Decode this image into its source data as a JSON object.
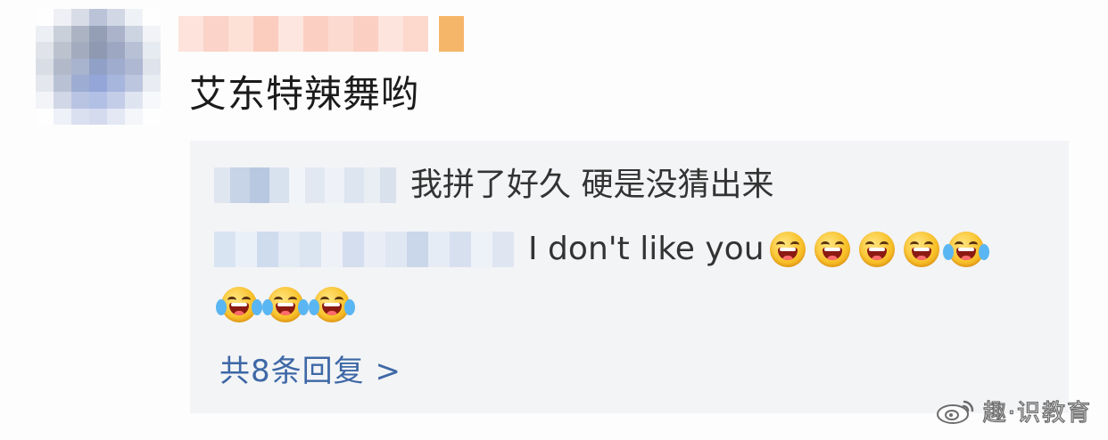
{
  "comment": {
    "text": "艾东特辣舞哟"
  },
  "replies": [
    {
      "text": "我拼了好久 硬是没猜出来"
    },
    {
      "text": "I don't like you",
      "emoji_inline": [
        "grinning-face-icon",
        "grinning-face-icon",
        "grinning-face-icon",
        "grinning-face-icon",
        "tears-of-joy-icon"
      ],
      "emoji_wrapped": [
        "tears-of-joy-icon",
        "tears-of-joy-icon",
        "tears-of-joy-icon"
      ]
    }
  ],
  "more_replies": {
    "label": "共8条回复 >"
  },
  "watermark": {
    "icon": "weibo-logo-icon",
    "text": "趣·识教育"
  },
  "colors": {
    "reply_background": "#f3f4f6",
    "link": "#3e68a6",
    "comment_text": "#1b1b1b",
    "reply_text": "#333333"
  }
}
